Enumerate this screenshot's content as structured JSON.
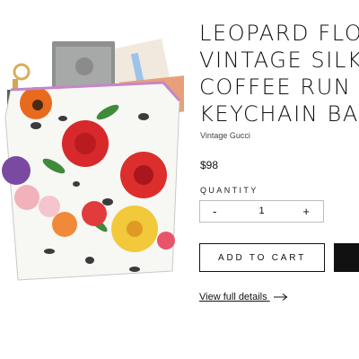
{
  "product": {
    "title_lines": [
      "LEOPARD FLO",
      "VINTAGE SILK",
      "COFFEE RUN",
      "KEYCHAIN BA"
    ],
    "vendor": "Vintage Gucci",
    "price": "$98"
  },
  "quantity": {
    "label": "QUANTITY",
    "minus": "-",
    "value": "1",
    "plus": "+"
  },
  "buttons": {
    "add_to_cart": "ADD TO CART"
  },
  "links": {
    "view_full_details": "View full details"
  },
  "colors": {
    "text": "#111111",
    "border": "#bdbdbd",
    "buy_button": "#111111"
  },
  "icons": {
    "arrow": "arrow-right-icon"
  }
}
